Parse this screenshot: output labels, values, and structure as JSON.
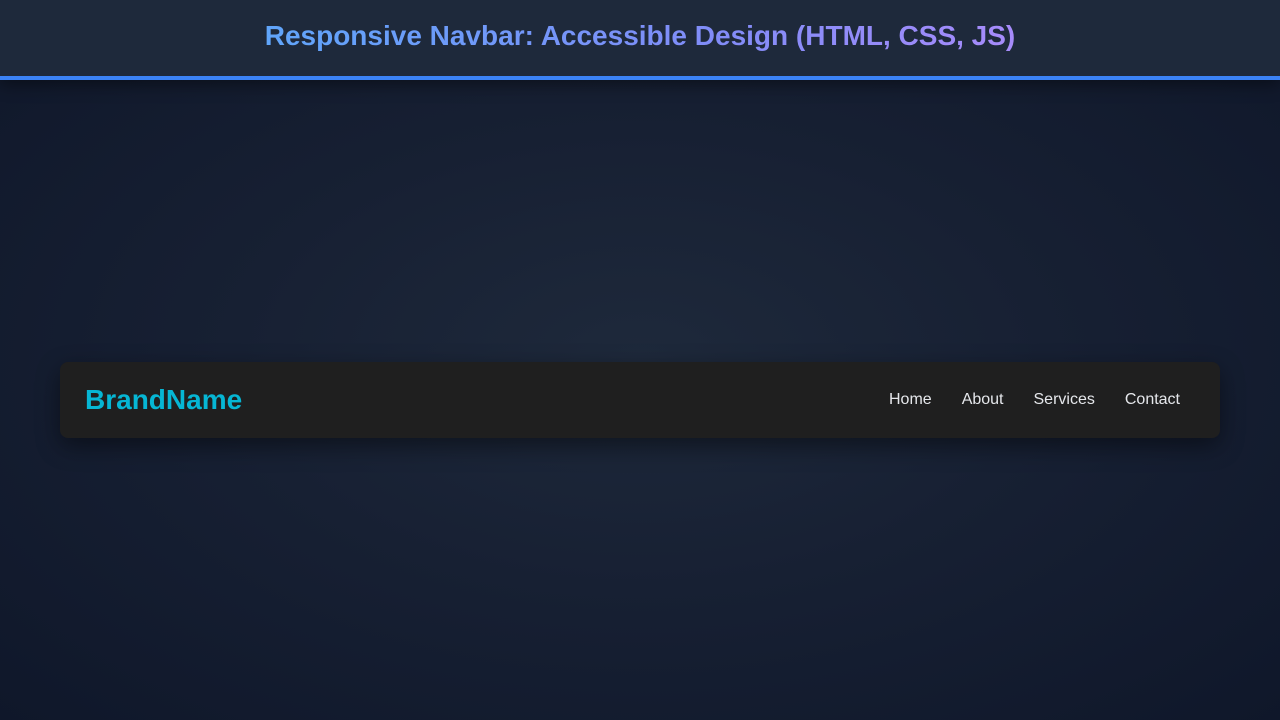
{
  "header": {
    "title": "Responsive Navbar: Accessible Design (HTML, CSS, JS)"
  },
  "navbar": {
    "brand": "BrandName",
    "links": [
      {
        "label": "Home"
      },
      {
        "label": "About"
      },
      {
        "label": "Services"
      },
      {
        "label": "Contact"
      }
    ]
  },
  "colors": {
    "header_accent": "#3b82f6",
    "brand": "#06b6d4",
    "navbar_background": "#1f1f1f",
    "page_background": "#172033"
  }
}
